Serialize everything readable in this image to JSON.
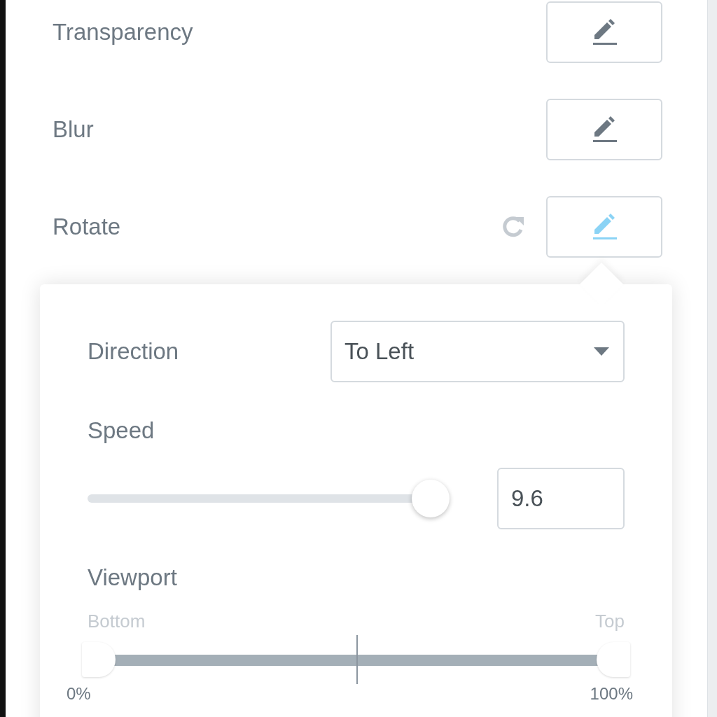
{
  "effects": [
    {
      "label": "Transparency",
      "active": false,
      "has_reset": false
    },
    {
      "label": "Blur",
      "active": false,
      "has_reset": false
    },
    {
      "label": "Rotate",
      "active": true,
      "has_reset": true
    }
  ],
  "popover": {
    "direction": {
      "label": "Direction",
      "value": "To Left"
    },
    "speed": {
      "label": "Speed",
      "level": 0.96,
      "value": "9.6"
    },
    "viewport": {
      "label": "Viewport",
      "start_label": "Bottom",
      "end_label": "Top",
      "handles": [
        {
          "level": 0
        },
        {
          "level": 1
        }
      ],
      "min": "0%",
      "max": "100%"
    }
  }
}
